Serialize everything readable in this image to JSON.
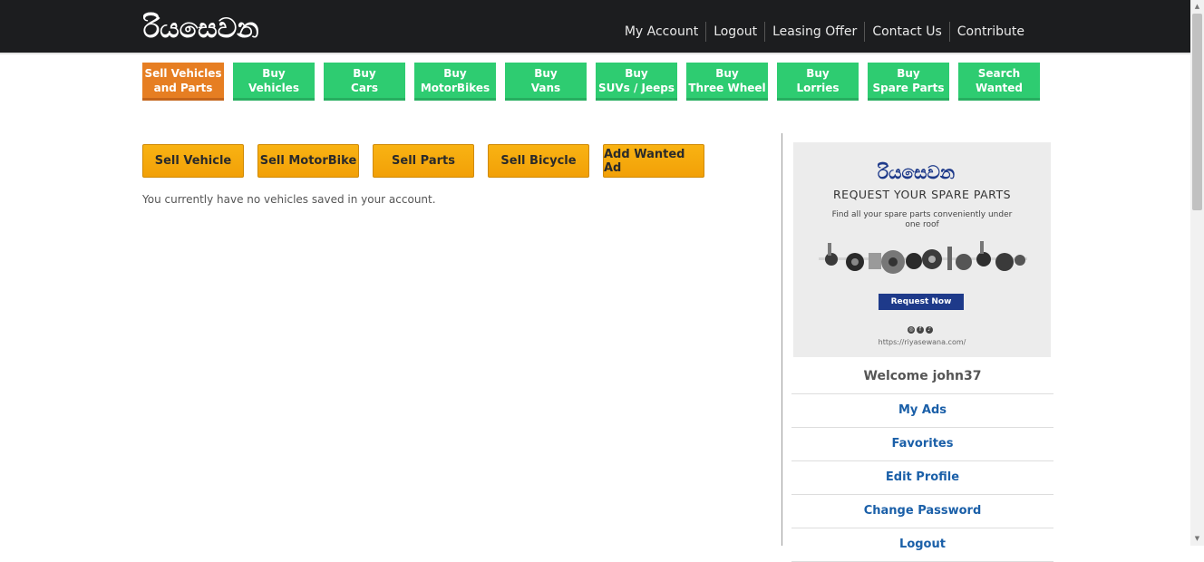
{
  "header": {
    "logo_text": "රියසෙවන",
    "nav": [
      "My Account",
      "Logout",
      "Leasing Offer",
      "Contact Us",
      "Contribute"
    ]
  },
  "categories": [
    {
      "line1": "Sell Vehicles",
      "line2": "and Parts",
      "active": true
    },
    {
      "line1": "Buy",
      "line2": "Vehicles"
    },
    {
      "line1": "Buy",
      "line2": "Cars"
    },
    {
      "line1": "Buy",
      "line2": "MotorBikes"
    },
    {
      "line1": "Buy",
      "line2": "Vans"
    },
    {
      "line1": "Buy",
      "line2": "SUVs / Jeeps"
    },
    {
      "line1": "Buy",
      "line2": "Three Wheel"
    },
    {
      "line1": "Buy",
      "line2": "Lorries"
    },
    {
      "line1": "Buy",
      "line2": "Spare Parts"
    },
    {
      "line1": "Search",
      "line2": "Wanted"
    }
  ],
  "sell_buttons": [
    "Sell Vehicle",
    "Sell MotorBike",
    "Sell Parts",
    "Sell Bicycle",
    "Add Wanted Ad"
  ],
  "empty_message": "You currently have no vehicles saved in your account.",
  "banner": {
    "logo_text": "රියසෙවන",
    "title": "REQUEST YOUR SPARE PARTS",
    "subtitle": "Find all your spare parts conveniently under one roof",
    "button": "Request Now",
    "social_icons": [
      "instagram-icon",
      "facebook-icon",
      "tiktok-icon"
    ],
    "url": "https://riyasewana.com/"
  },
  "sidebar": {
    "welcome": "Welcome john37",
    "items": [
      "My Ads",
      "Favorites",
      "Edit Profile",
      "Change Password",
      "Logout"
    ]
  },
  "colors": {
    "topbar": "#1c1d1f",
    "category_green": "#2ecc71",
    "category_active": "#e67e22",
    "sell_button": "#f4a80b",
    "link_blue": "#1a5fa8"
  }
}
